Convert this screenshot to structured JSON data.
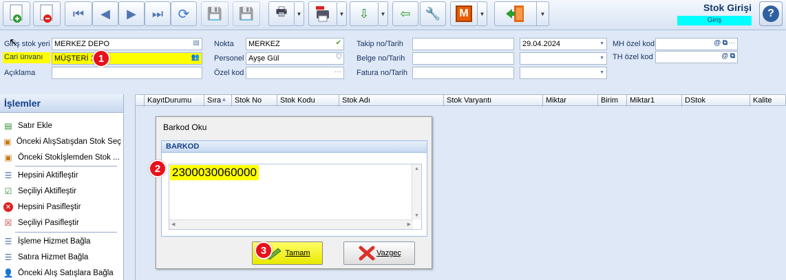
{
  "toolbar": {
    "title": "Stok Girişi",
    "mode": "Giriş",
    "m_label": "M"
  },
  "form": {
    "giris_stok_yeri_label": "Giriş stok yeri",
    "giris_stok_yeri_value": "MERKEZ DEPO",
    "cari_unvani_label": "Cari ünvanı",
    "cari_unvani_value": "MÜŞTERİ 1",
    "aciklama_label": "Açıklama",
    "aciklama_value": "",
    "nokta_label": "Nokta",
    "nokta_value": "MERKEZ",
    "personel_label": "Personel",
    "personel_value": "Ayşe Gül",
    "ozel_kod_label": "Özel kod",
    "ozel_kod_value": "",
    "takip_label": "Takip no/Tarih",
    "takip_value": "",
    "takip_date": "29.04.2024",
    "belge_label": "Belge no/Tarih",
    "belge_value": "",
    "belge_date": "",
    "fatura_label": "Fatura no/Tarih",
    "fatura_value": "",
    "fatura_date": "",
    "mh_label": "MH özel kod",
    "mh_value": "",
    "th_label": "TH özel kod",
    "th_value": ""
  },
  "markers": [
    "1",
    "2",
    "3"
  ],
  "left_panel": {
    "title": "İşlemler",
    "items": [
      "Satır Ekle",
      "Önceki AlışSatışdan Stok Seç",
      "Önceki Stokİşlemden Stok ...",
      "Hepsini Aktifleştir",
      "Seçiliyi Aktifleştir",
      "Hepsini Pasifleştir",
      "Seçiliyi Pasifleştir",
      "İşleme Hizmet Bağla",
      "Satıra Hizmet Bağla",
      "Önceki Alış Satışlara Bağla"
    ]
  },
  "grid": {
    "columns": [
      "KayıtDurumu",
      "Sıra",
      "Stok No",
      "Stok Kodu",
      "Stok Adı",
      "Stok Varyantı",
      "Miktar",
      "Birim",
      "Miktar1",
      "DStok",
      "Kalite"
    ]
  },
  "dialog": {
    "title": "Barkod Oku",
    "group_title": "BARKOD",
    "barcode_value": "2300030060000",
    "ok_label": "Tamam",
    "cancel_label": "Vazgeç"
  }
}
